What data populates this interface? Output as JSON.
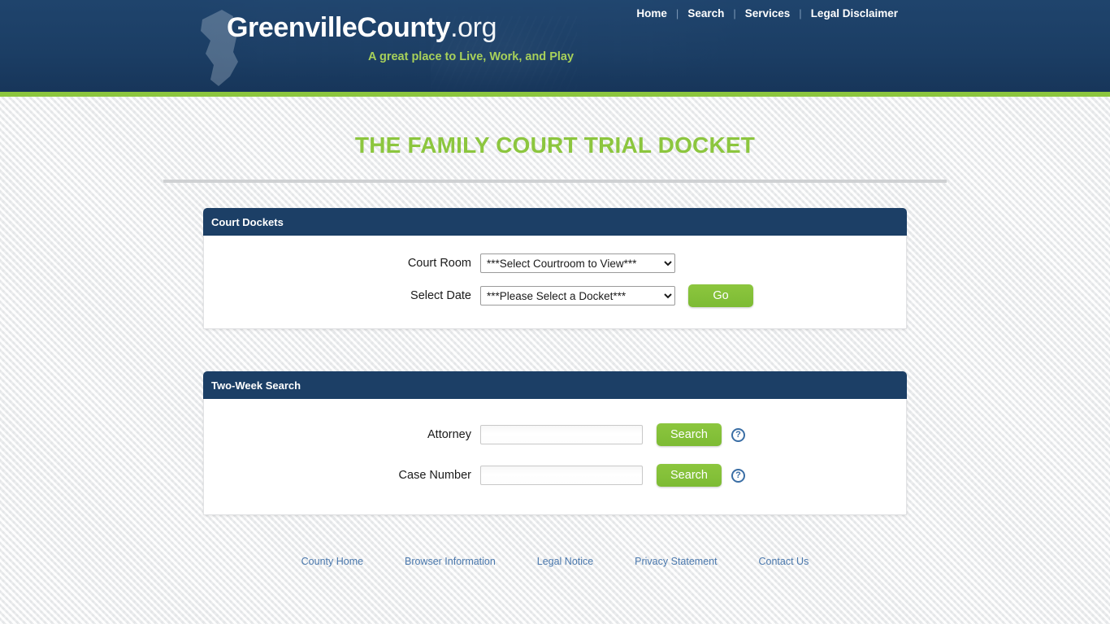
{
  "header": {
    "brand_name": "GreenvilleCounty",
    "brand_tld": ".org",
    "tagline": "A great place to Live, Work, and Play",
    "nav": [
      {
        "label": "Home"
      },
      {
        "label": "Search"
      },
      {
        "label": "Services"
      },
      {
        "label": "Legal Disclaimer"
      }
    ],
    "nav_separator": "|",
    "accent_green": "#8cc63e",
    "navy": "#1c3f66"
  },
  "page": {
    "title": "THE FAMILY COURT TRIAL DOCKET"
  },
  "dockets_panel": {
    "heading": "Court Dockets",
    "court_room": {
      "label": "Court Room",
      "selected": "***Select Courtroom to View***",
      "options": [
        "***Select Courtroom to View***"
      ]
    },
    "select_date": {
      "label": "Select Date",
      "selected": "***Please Select a Docket***",
      "options": [
        "***Please Select a Docket***"
      ]
    },
    "go_label": "Go"
  },
  "search_panel": {
    "heading": "Two-Week Search",
    "attorney": {
      "label": "Attorney",
      "value": "",
      "placeholder": "",
      "button_label": "Search",
      "help_glyph": "?"
    },
    "case_number": {
      "label": "Case Number",
      "value": "",
      "placeholder": "",
      "button_label": "Search",
      "help_glyph": "?"
    }
  },
  "footer": {
    "links": [
      {
        "label": "County Home"
      },
      {
        "label": "Browser Information"
      },
      {
        "label": "Legal Notice"
      },
      {
        "label": "Privacy Statement"
      },
      {
        "label": "Contact Us"
      }
    ]
  }
}
